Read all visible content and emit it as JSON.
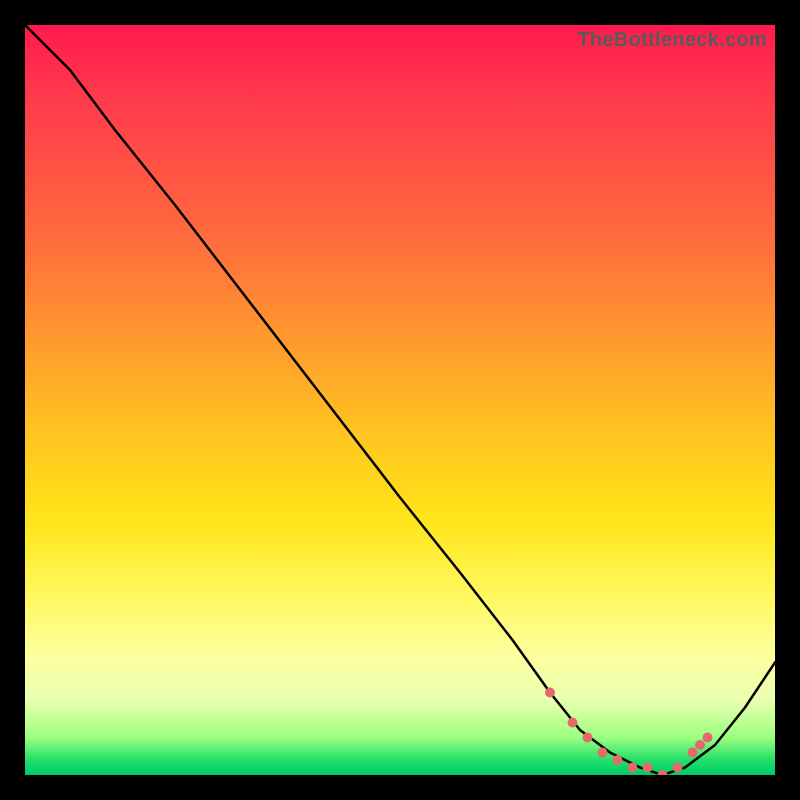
{
  "watermark": "TheBottleneck.com",
  "colors": {
    "curve_stroke": "#000000",
    "dot_fill": "#e46a6a",
    "background": "#000000"
  },
  "chart_data": {
    "type": "line",
    "title": "",
    "xlabel": "",
    "ylabel": "",
    "xlim": [
      0,
      100
    ],
    "ylim": [
      0,
      100
    ],
    "grid": false,
    "legend": false,
    "series": [
      {
        "name": "bottleneck-curve",
        "x": [
          0,
          6,
          12,
          20,
          30,
          40,
          50,
          58,
          65,
          70,
          74,
          78,
          82,
          85,
          88,
          92,
          96,
          100
        ],
        "y": [
          100,
          94,
          86,
          76,
          63,
          50,
          37,
          27,
          18,
          11,
          6,
          3,
          1,
          0,
          1,
          4,
          9,
          15
        ]
      }
    ],
    "highlight_dots": {
      "x": [
        70,
        73,
        75,
        77,
        79,
        81,
        83,
        85,
        87,
        89,
        90,
        91
      ],
      "y": [
        11,
        7,
        5,
        3,
        2,
        1,
        1,
        0,
        1,
        3,
        4,
        5
      ]
    }
  }
}
